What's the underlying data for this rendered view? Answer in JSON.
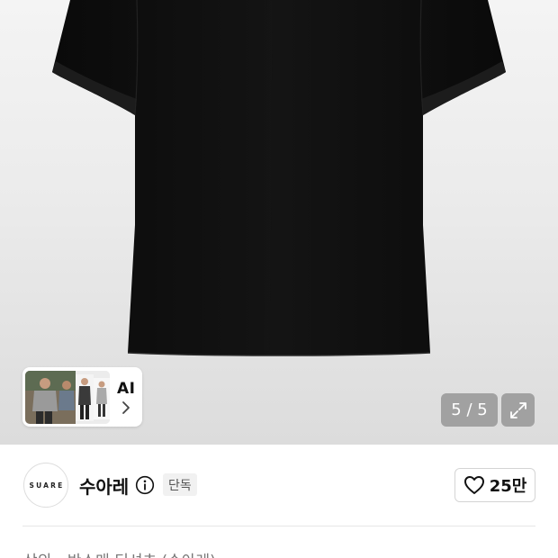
{
  "gallery": {
    "counter": "5 / 5",
    "ai_label": "AI",
    "expand_icon": "expand-icon",
    "background": "#e4e4e4",
    "product_color": "#0d0d0d"
  },
  "brand": {
    "logo_text": "SUARE",
    "name": "수아레",
    "badge": "단독",
    "like_count": "25만",
    "like_icon": "heart-outline-icon"
  },
  "product": {
    "breadcrumb": "상의 › 반소매 티셔츠 (수아레)"
  }
}
